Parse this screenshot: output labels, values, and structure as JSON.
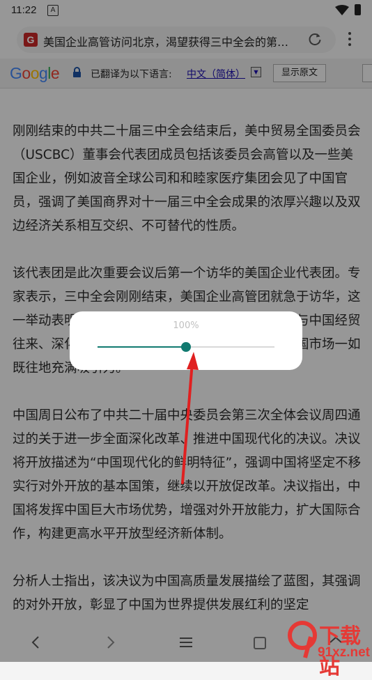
{
  "status_bar": {
    "time": "11:22",
    "notification_glyph": "A",
    "icons": [
      "wifi-icon",
      "battery-icon"
    ]
  },
  "browser": {
    "favicon_letter": "G",
    "page_title": "美国企业高管访问北京，渴望获得三中全会的第…"
  },
  "translate_bar": {
    "logo": "Google",
    "translated_to_label": "已翻译为以下语言:",
    "language": "中文（简体）",
    "show_original_button": "显示原文"
  },
  "article": {
    "paragraphs": [
      "刚刚结束的中共二十届三中全会结束后，美中贸易全国委员会（USCBC）董事会代表团成员包括该委员会高管以及一些美国企业，例如波音全球公司和和睦家医疗集团会见了中国官员，强调了美国商界对十一届三中全会成果的浓厚兴趣以及双边经济关系相互交织、不可替代的性质。",
      "该代表团是此次重要会议后第一个访华的美国企业代表团。专家表示，三中全会刚刚结束，美国企业高管团就急于访华，这一举动表明三中全会的成果引起了美国工商界加强与中国经贸往来、深化合作的浓厚兴趣和合作，进一步表明中国市场一如既往地充满吸引力。",
      "中国周日公布了中共二十届中央委员会第三次全体会议周四通过的关于进一步全面深化改革、推进中国现代化的决议。决议将开放描述为“中国现代化的鲜明特征”，强调中国将坚定不移实行对外开放的基本国策，继续以开放促改革。决议指出，中国将发挥中国巨大市场优势，增强对外开放能力，扩大国际合作，构建更高水平开放型经济新体制。",
      "分析人士指出，该决议为中国高质量发展描绘了蓝图，其强调的对外开放，彰显了中国为世界提供发展红利的坚定"
    ]
  },
  "zoom_popup": {
    "label": "100%",
    "slider_fraction": 0.5,
    "accent_color": "#117a70"
  },
  "annotation": {
    "arrow_color": "#e02020"
  },
  "watermark": {
    "logo_glyph": "9",
    "title": "下载站",
    "url": "91xz.net"
  }
}
